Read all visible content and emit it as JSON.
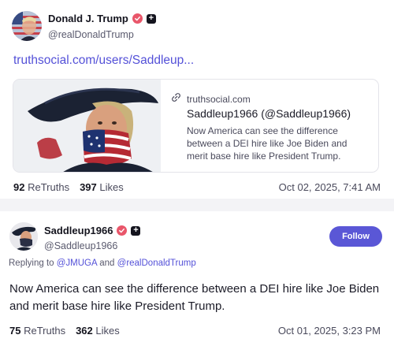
{
  "post1": {
    "author": {
      "display_name": "Donald J. Trump",
      "handle": "@realDonaldTrump",
      "avatar_icon": "avatar-flag-portrait-icon",
      "verified_icon": "verified-check-icon",
      "badge_icon": "plus-badge-icon"
    },
    "link": "truthsocial.com/users/Saddleup...",
    "card": {
      "domain": "truthsocial.com",
      "title": "Saddleup1966 (@Saddleup1966)",
      "description": "Now America can see the difference between a DEI hire like Joe Biden and merit base hire like President Trump."
    },
    "stats": {
      "retruths_count": "92",
      "retruths_label": "ReTruths",
      "likes_count": "397",
      "likes_label": "Likes"
    },
    "timestamp": "Oct 02, 2025, 7:41 AM"
  },
  "post2": {
    "author": {
      "display_name": "Saddleup1966",
      "handle": "@Saddleup1966",
      "avatar_icon": "avatar-tricorn-patriot-icon",
      "verified_icon": "verified-check-icon",
      "badge_icon": "plus-badge-icon"
    },
    "follow_label": "Follow",
    "reply": {
      "prefix": "Replying to",
      "mention1": "@JMUGA",
      "and": "and",
      "mention2": "@realDonaldTrump"
    },
    "text": "Now America can see the difference between a DEI hire like Joe Biden and merit base hire like President Trump.",
    "stats": {
      "retruths_count": "75",
      "retruths_label": "ReTruths",
      "likes_count": "362",
      "likes_label": "Likes"
    },
    "timestamp": "Oct 01, 2025, 3:23 PM"
  },
  "colors": {
    "accent": "#5451d8",
    "follow_button": "#5a57d6",
    "verified": "#e9566a",
    "separator": "#f3f3f6"
  }
}
